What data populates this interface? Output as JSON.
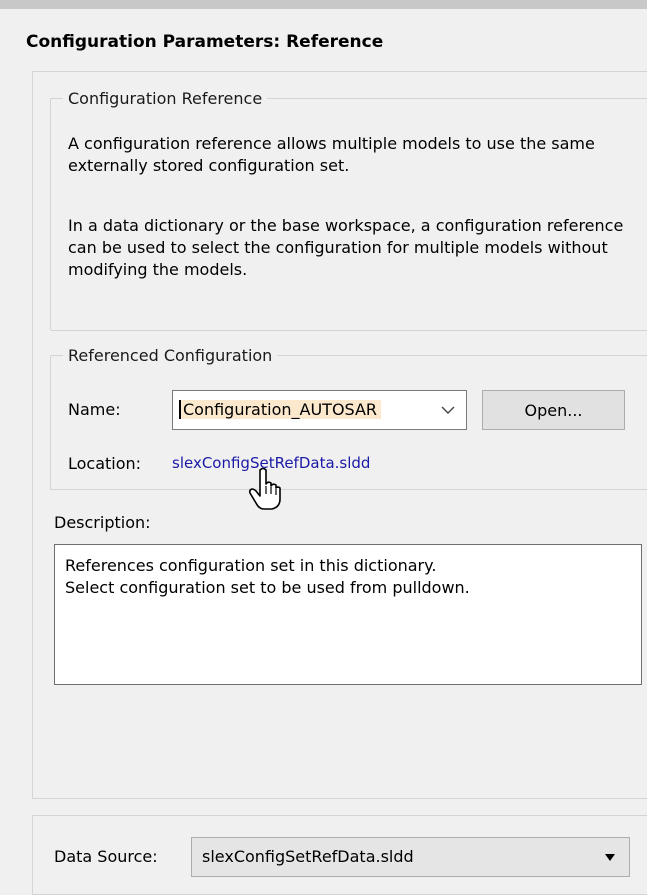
{
  "header": {
    "title": "Configuration Parameters: Reference"
  },
  "configuration_reference": {
    "legend": "Configuration Reference",
    "paragraph1": "A configuration reference allows multiple models to use the same externally stored configuration set.",
    "paragraph2": "In a data dictionary or the base workspace, a configuration reference can be used to select the configuration for multiple models without modifying the models."
  },
  "referenced_configuration": {
    "legend": "Referenced Configuration",
    "name_label": "Name:",
    "name_value": "Configuration_AUTOSAR",
    "open_button": "Open...",
    "location_label": "Location:",
    "location_link": "slexConfigSetRefData.sldd"
  },
  "description": {
    "label": "Description:",
    "line1": "References configuration set in this dictionary.",
    "line2": "Select configuration set to be used from pulldown."
  },
  "data_source": {
    "label": "Data Source:",
    "value": "slexConfigSetRefData.sldd"
  },
  "icons": {
    "combo_arrow": "chevron-down-icon",
    "cursor": "hand-pointer-icon",
    "select_arrow": "caret-down-icon"
  }
}
